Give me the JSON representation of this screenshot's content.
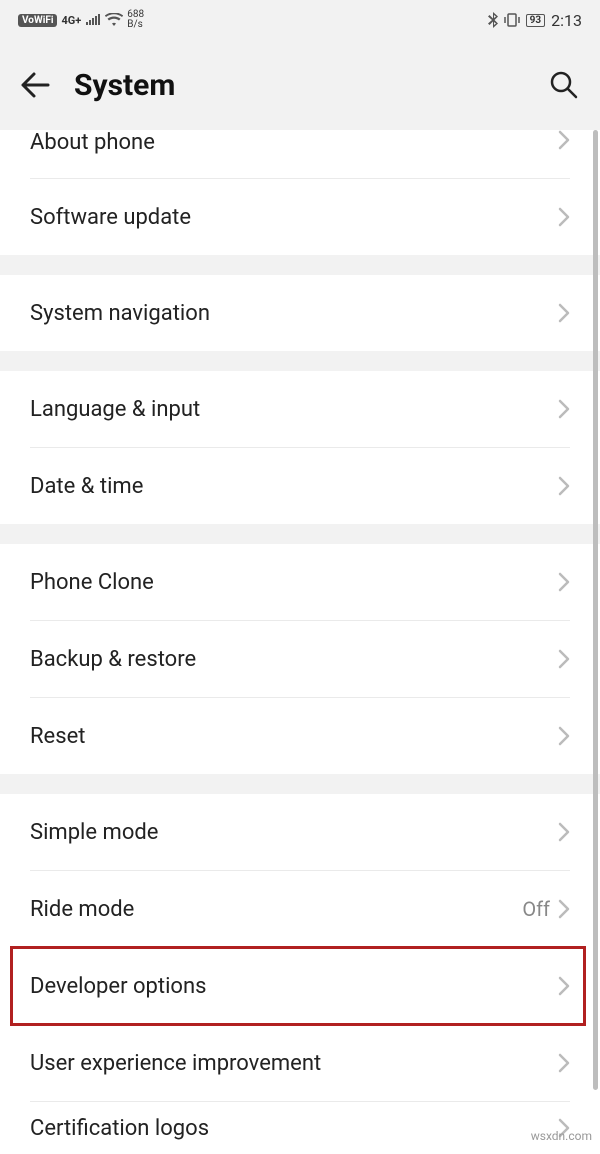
{
  "status": {
    "vowifi": "VoWiFi",
    "network": "4G+",
    "speed_num": "688",
    "speed_unit": "B/s",
    "battery": "93",
    "time": "2:13"
  },
  "header": {
    "title": "System"
  },
  "groups": [
    {
      "items": [
        {
          "id": "about-phone",
          "label": "About phone",
          "partial": true
        },
        {
          "id": "software-update",
          "label": "Software update"
        }
      ]
    },
    {
      "items": [
        {
          "id": "system-navigation",
          "label": "System navigation"
        }
      ]
    },
    {
      "items": [
        {
          "id": "language-input",
          "label": "Language & input"
        },
        {
          "id": "date-time",
          "label": "Date & time"
        }
      ]
    },
    {
      "items": [
        {
          "id": "phone-clone",
          "label": "Phone Clone"
        },
        {
          "id": "backup-restore",
          "label": "Backup & restore"
        },
        {
          "id": "reset",
          "label": "Reset"
        }
      ]
    },
    {
      "items": [
        {
          "id": "simple-mode",
          "label": "Simple mode"
        },
        {
          "id": "ride-mode",
          "label": "Ride mode",
          "value": "Off"
        },
        {
          "id": "developer-options",
          "label": "Developer options",
          "highlight": true
        },
        {
          "id": "user-experience",
          "label": "User experience improvement"
        },
        {
          "id": "certification-logos",
          "label": "Certification logos",
          "cut": true
        }
      ]
    }
  ],
  "watermark": "wsxdn.com"
}
